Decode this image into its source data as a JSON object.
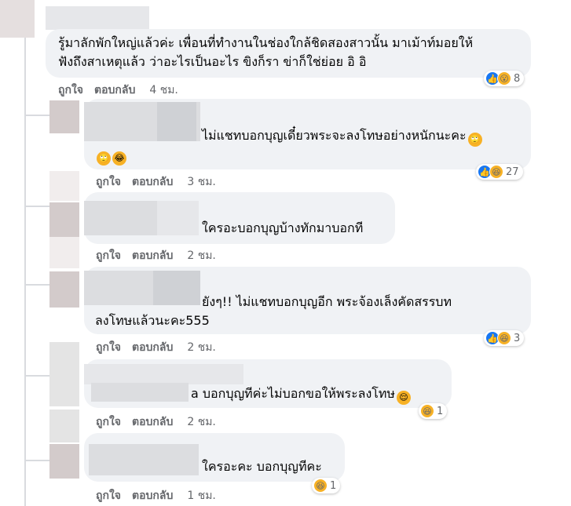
{
  "comments": [
    {
      "text_lines": [
        "รู้มาลักพักใหญ่แล้วค่ะ เพื่อนที่ทำงานในช่องใกล้ชิดสองสาวนั้น มาเม้าท์มอยให้",
        "ฟังถึงสาเหตุแล้ว ว่าอะไรเป็นอะไร ขิงก็รา ข่าก็ใช่ย่อย อิ อิ"
      ],
      "like_label": "ถูกใจ",
      "reply_label": "ตอบกลับ",
      "time": "4 ชม.",
      "reaction_count": "8",
      "reaction_icons": [
        "like-icon",
        "wow-icon"
      ]
    },
    {
      "text_lines": [
        "ไม่แชทบอกบุญเดี๋ยวพระจะลงโทษอย่างหนักนะคะ",
        ""
      ],
      "like_label": "ถูกใจ",
      "reply_label": "ตอบกลับ",
      "time": "3 ชม.",
      "reaction_count": "27",
      "reaction_icons": [
        "like-icon",
        "haha-icon"
      ]
    },
    {
      "text_lines": [
        "ใครอะบอกบุญบ้างทักมาบอกที"
      ],
      "like_label": "ถูกใจ",
      "reply_label": "ตอบกลับ",
      "time": "2 ชม."
    },
    {
      "text_lines": [
        "ยังๆ!! ไม่แชทบอกบุญอีก พระจ้องเล็งคัดสรรบท",
        "ลงโทษแล้วนะคะ555"
      ],
      "like_label": "ถูกใจ",
      "reply_label": "ตอบกลับ",
      "time": "2 ชม.",
      "reaction_count": "3",
      "reaction_icons": [
        "like-icon",
        "haha-icon"
      ]
    },
    {
      "text_lines": [
        "a บอกบุญทีค่ะไม่บอกขอให้พระลงโทษ"
      ],
      "like_label": "ถูกใจ",
      "reply_label": "ตอบกลับ",
      "time": "2 ชม.",
      "reaction_count": "1",
      "reaction_icons": [
        "haha-icon"
      ]
    },
    {
      "text_lines": [
        "ใครอะคะ บอกบุญทีคะ"
      ],
      "like_label": "ถูกใจ",
      "reply_label": "ตอบกลับ",
      "time": "1 ชม.",
      "reaction_count": "1",
      "reaction_icons": [
        "haha-icon"
      ]
    }
  ],
  "colors": {
    "bubble": "#f0f2f5",
    "action_text": "#65676b",
    "like_blue": "#1877f2",
    "emoji_yellow": "#f7b125"
  }
}
